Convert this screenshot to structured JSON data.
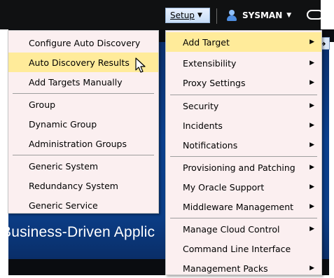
{
  "topbar": {
    "setup_label": "Setup",
    "user_label": "SYSMAN"
  },
  "background": {
    "banner_text": "Business-Driven Applic"
  },
  "setup_menu": {
    "items": [
      {
        "label": "Add Target",
        "submenu": true,
        "highlight": true
      },
      {
        "label": "Extensibility",
        "submenu": true
      },
      {
        "label": "Proxy Settings",
        "submenu": true
      },
      {
        "label": "Security",
        "submenu": true
      },
      {
        "label": "Incidents",
        "submenu": true
      },
      {
        "label": "Notifications",
        "submenu": true
      },
      {
        "label": "Provisioning and Patching",
        "submenu": true
      },
      {
        "label": "My Oracle Support",
        "submenu": true
      },
      {
        "label": "Middleware Management",
        "submenu": true
      },
      {
        "label": "Manage Cloud Control",
        "submenu": true
      },
      {
        "label": "Command Line Interface",
        "submenu": false
      },
      {
        "label": "Management Packs",
        "submenu": true
      }
    ]
  },
  "add_target_menu": {
    "items": [
      {
        "label": "Configure Auto Discovery"
      },
      {
        "label": "Auto Discovery Results",
        "highlight": true
      },
      {
        "label": "Add Targets Manually"
      },
      {
        "label": "Group"
      },
      {
        "label": "Dynamic Group"
      },
      {
        "label": "Administration Groups"
      },
      {
        "label": "Generic System"
      },
      {
        "label": "Redundancy System"
      },
      {
        "label": "Generic Service"
      }
    ]
  },
  "colors": {
    "highlight": "#ffeb9a",
    "menu_bg": "#fbeff0",
    "topbar": "#101112"
  },
  "icons": [
    "user-icon",
    "pill-icon",
    "chevron-down-icon",
    "chevron-right-icon",
    "arrow-right-icon",
    "pointer-cursor-icon"
  ]
}
